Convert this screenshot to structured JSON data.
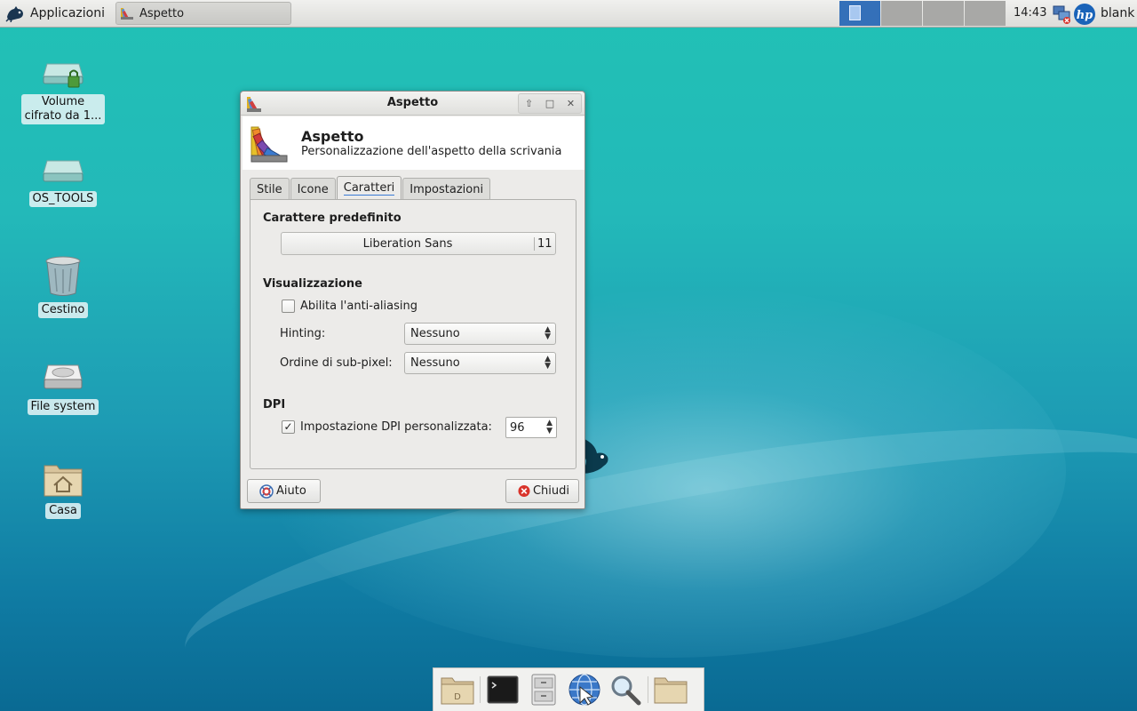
{
  "panel": {
    "apps_label": "Applicazioni",
    "task_label": "Aspetto",
    "clock": "14:43",
    "user": "blank"
  },
  "desktop_icons": [
    {
      "label_l1": "Volume",
      "label_l2": "cifrato da 1..."
    },
    {
      "label": "OS_TOOLS"
    },
    {
      "label": "Cestino"
    },
    {
      "label": "File system"
    },
    {
      "label": "Casa"
    }
  ],
  "dialog": {
    "title": "Aspetto",
    "header_title": "Aspetto",
    "header_subtitle": "Personalizzazione dell'aspetto della scrivania",
    "tabs": [
      "Stile",
      "Icone",
      "Caratteri",
      "Impostazioni"
    ],
    "active_tab": "Caratteri",
    "font_section": "Carattere predefinito",
    "font_name": "Liberation Sans",
    "font_size": "11",
    "render_section": "Visualizzazione",
    "antialias_label": "Abilita l'anti-aliasing",
    "antialias_checked": false,
    "hinting_label": "Hinting:",
    "hinting_value": "Nessuno",
    "subpixel_label": "Ordine di sub-pixel:",
    "subpixel_value": "Nessuno",
    "dpi_section": "DPI",
    "dpi_label": "Impostazione DPI personalizzata:",
    "dpi_checked": true,
    "dpi_value": "96",
    "help_button": "Aiuto",
    "close_button": "Chiudi"
  },
  "icons": {
    "apps": "mouse-logo-icon",
    "tray": [
      "network-disconnected-icon",
      "hp-icon"
    ],
    "dock": [
      "home-folder-icon",
      "terminal-icon",
      "file-manager-icon",
      "web-browser-icon",
      "search-icon",
      "folder-icon"
    ]
  },
  "colors": {
    "accent": "#3470b9",
    "close_red": "#d9342b"
  }
}
